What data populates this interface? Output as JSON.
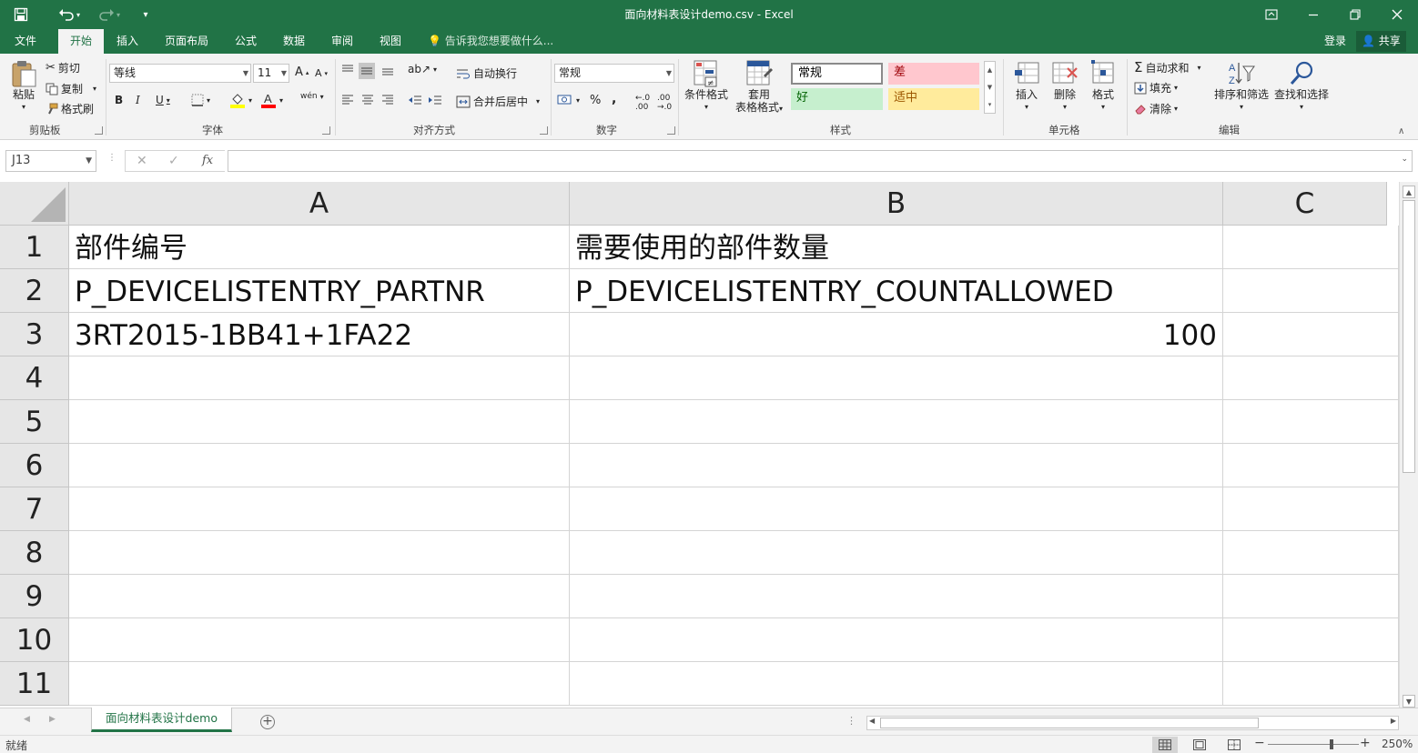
{
  "window": {
    "title": "面向材料表设计demo.csv - Excel"
  },
  "ribbon_tabs": [
    {
      "label": "文件"
    },
    {
      "label": "开始"
    },
    {
      "label": "插入"
    },
    {
      "label": "页面布局"
    },
    {
      "label": "公式"
    },
    {
      "label": "数据"
    },
    {
      "label": "审阅"
    },
    {
      "label": "视图"
    }
  ],
  "tell_me": "告诉我您想要做什么...",
  "account": {
    "login": "登录",
    "share": "共享"
  },
  "clipboard": {
    "paste": "粘贴",
    "cut": "剪切",
    "copy": "复制",
    "format_painter": "格式刷",
    "label": "剪贴板"
  },
  "font": {
    "name": "等线",
    "size": "11",
    "bold": "B",
    "italic": "I",
    "underline": "U",
    "label": "字体",
    "grow": "A",
    "shrink": "A"
  },
  "alignment": {
    "wrap": "自动换行",
    "merge": "合并后居中",
    "label": "对齐方式"
  },
  "number": {
    "format": "常规",
    "percent": "%",
    "comma": ",",
    "label": "数字"
  },
  "styles": {
    "conditional": "条件格式",
    "format_table_1": "套用",
    "format_table_2": "表格格式",
    "normal": "常规",
    "bad": "差",
    "good": "好",
    "neutral": "适中",
    "label": "样式"
  },
  "cells_group": {
    "insert": "插入",
    "delete": "删除",
    "format": "格式",
    "label": "单元格"
  },
  "editing": {
    "autosum": "自动求和",
    "fill": "填充",
    "clear": "清除",
    "sort_filter": "排序和筛选",
    "find_select": "查找和选择",
    "label": "编辑"
  },
  "formula_bar": {
    "name_box": "J13",
    "fx": "fx",
    "formula": ""
  },
  "sheet": {
    "columns": [
      "A",
      "B",
      "C"
    ],
    "rows": [
      "1",
      "2",
      "3",
      "4",
      "5",
      "6",
      "7",
      "8",
      "9",
      "10",
      "11"
    ],
    "cells": {
      "A1": "部件编号",
      "B1": "需要使用的部件数量",
      "A2": "P_DEVICELISTENTRY_PARTNR",
      "B2": "P_DEVICELISTENTRY_COUNTALLOWED",
      "A3": "3RT2015-1BB41+1FA22",
      "B3": "100"
    }
  },
  "sheet_tabs": [
    {
      "label": "面向材料表设计demo"
    }
  ],
  "status": {
    "ready": "就绪",
    "zoom": "250%",
    "minus": "−",
    "plus": "+"
  },
  "colors": {
    "accent": "#217346",
    "bad_bg": "#ffc7ce",
    "bad_fg": "#9c0006",
    "good_bg": "#c6efce",
    "good_fg": "#006100",
    "neutral_bg": "#ffeb9c",
    "neutral_fg": "#9c5700"
  }
}
